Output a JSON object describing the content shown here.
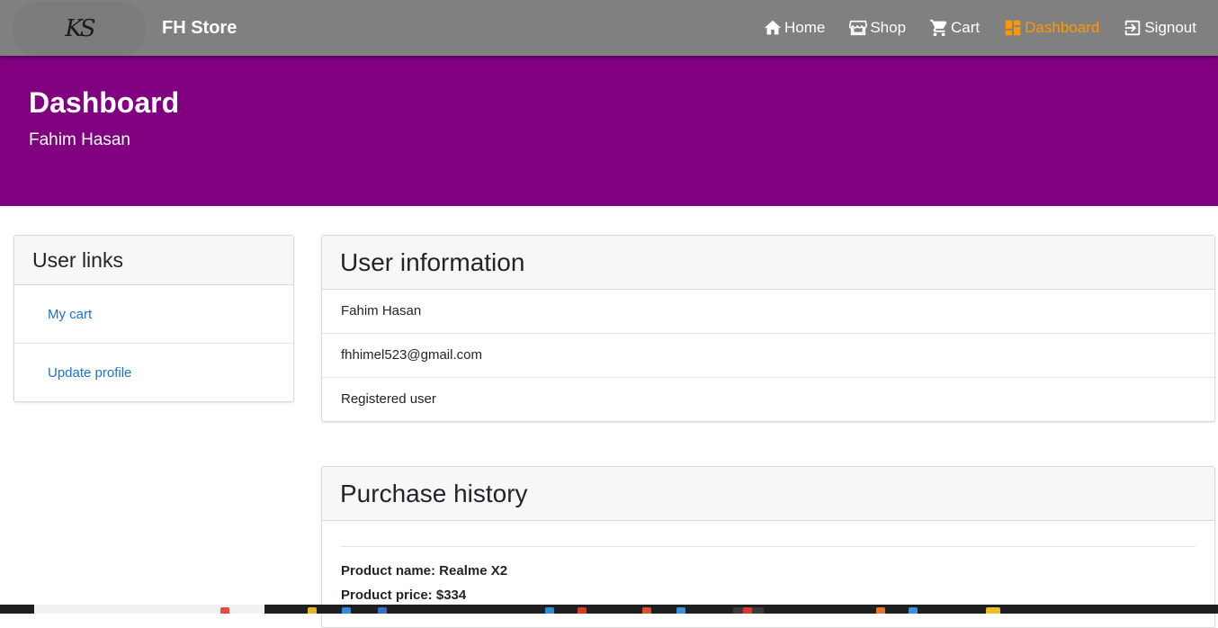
{
  "navbar": {
    "logo_text": "KS",
    "brand": "FH Store",
    "items": [
      {
        "label": "Home",
        "icon": "home-icon",
        "active": false
      },
      {
        "label": "Shop",
        "icon": "store-icon",
        "active": false
      },
      {
        "label": "Cart",
        "icon": "cart-icon",
        "active": false
      },
      {
        "label": "Dashboard",
        "icon": "dashboard-icon",
        "active": true
      },
      {
        "label": "Signout",
        "icon": "signout-icon",
        "active": false
      }
    ]
  },
  "hero": {
    "title": "Dashboard",
    "subtitle": "Fahim Hasan"
  },
  "user_links": {
    "title": "User links",
    "items": [
      {
        "label": "My cart"
      },
      {
        "label": "Update profile"
      }
    ]
  },
  "user_info": {
    "title": "User information",
    "name": "Fahim Hasan",
    "email": "fhhimel523@gmail.com",
    "role": "Registered user"
  },
  "purchase_history": {
    "title": "Purchase history",
    "entries": [
      {
        "product_name": "Product name: Realme X2",
        "product_price": "Product price: $334"
      }
    ]
  },
  "colors": {
    "navbar": "#808080",
    "hero": "#800080",
    "active_nav": "#ff9800",
    "link": "#1a73c8"
  }
}
